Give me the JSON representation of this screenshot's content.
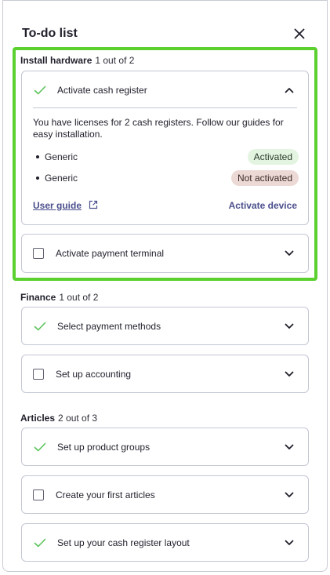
{
  "header": {
    "title": "To-do list",
    "close_icon": "close-icon"
  },
  "colors": {
    "highlight": "#5bd02f",
    "check": "#5bc35b",
    "activated_bg": "#e3f5e1",
    "not_activated_bg": "#ecd9d5",
    "link": "#4b4f8c"
  },
  "sections": {
    "install": {
      "name": "Install hardware",
      "count": "1 out of 2",
      "task1": {
        "label": "Activate cash register",
        "done": true,
        "description": "You have licenses for 2 cash registers. Follow our guides for easy installation.",
        "devices": [
          {
            "name": "Generic",
            "status": "Activated"
          },
          {
            "name": "Generic",
            "status": "Not activated"
          }
        ],
        "user_guide": "User guide",
        "activate_device": "Activate device"
      },
      "task2": {
        "label": "Activate payment terminal",
        "done": false
      }
    },
    "finance": {
      "name": "Finance",
      "count": "1 out of 2",
      "task1": {
        "label": "Select payment methods",
        "done": true
      },
      "task2": {
        "label": "Set up accounting",
        "done": false
      }
    },
    "articles": {
      "name": "Articles",
      "count": "2 out of 3",
      "task1": {
        "label": "Set up product groups",
        "done": true
      },
      "task2": {
        "label": "Create your first articles",
        "done": false
      },
      "task3": {
        "label": "Set up your cash register layout",
        "done": true
      }
    }
  }
}
